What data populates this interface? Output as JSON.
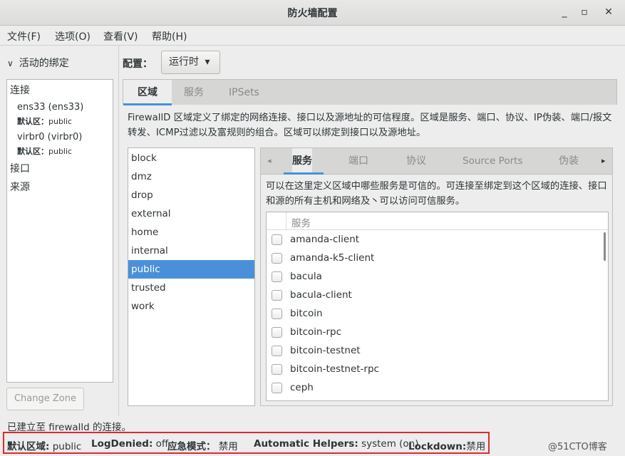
{
  "window": {
    "title": "防火墙配置"
  },
  "window_controls": {
    "minimize": "_",
    "maximize": "▫",
    "close": "✕"
  },
  "menu": [
    "文件(F)",
    "选项(O)",
    "查看(V)",
    "帮助(H)"
  ],
  "left_panel": {
    "header_arrow": "∨",
    "header": "活动的绑定",
    "connections_label": "连接",
    "connections": [
      {
        "name": "ens33 (ens33)",
        "zone_label": "默认区：",
        "zone": "public"
      },
      {
        "name": "virbr0 (virbr0)",
        "zone_label": "默认区：",
        "zone": "public"
      }
    ],
    "interfaces_label": "接口",
    "sources_label": "来源",
    "change_zone_button": "Change Zone"
  },
  "config": {
    "label": "配置：",
    "value": "运行时",
    "dropdown_icon": "▾"
  },
  "main_tabs": [
    "区域",
    "服务",
    "IPSets"
  ],
  "zone_description": "FirewallD 区域定义了绑定的网络连接、接口以及源地址的可信程度。区域是服务、端口、协议、IP伪装、端口/报文转发、ICMP过滤以及富规则的组合。区域可以绑定到接口以及源地址。",
  "zones": [
    "block",
    "dmz",
    "drop",
    "external",
    "home",
    "internal",
    "public",
    "trusted",
    "work"
  ],
  "selected_zone": "public",
  "sub_tabs": {
    "left_arrow": "◂",
    "right_arrow": "▸",
    "items": [
      "服务",
      "端口",
      "协议",
      "Source Ports",
      "伪装"
    ]
  },
  "services_description": "可以在这里定义区域中哪些服务是可信的。可连接至绑定到这个区域的连接、接口和源的所有主机和网络及丶可以访问可信服务。",
  "services_header": "服务",
  "services": [
    "amanda-client",
    "amanda-k5-client",
    "bacula",
    "bacula-client",
    "bitcoin",
    "bitcoin-rpc",
    "bitcoin-testnet",
    "bitcoin-testnet-rpc",
    "ceph"
  ],
  "status_connection": "已建立至  firewalld 的连接。",
  "status": {
    "default_zone_label": "默认区域:",
    "default_zone": "public",
    "log_denied_label": "LogDenied:",
    "log_denied": "off",
    "panic_label": "应急模式：",
    "panic": "禁用",
    "helpers_label": "Automatic Helpers:",
    "helpers": "system (on)",
    "lockdown_label": "Lockdown:",
    "lockdown": "禁用"
  },
  "watermark": "@51CTO博客",
  "colors": {
    "selection": "#4a90d9",
    "highlight_border": "#e0292c"
  }
}
